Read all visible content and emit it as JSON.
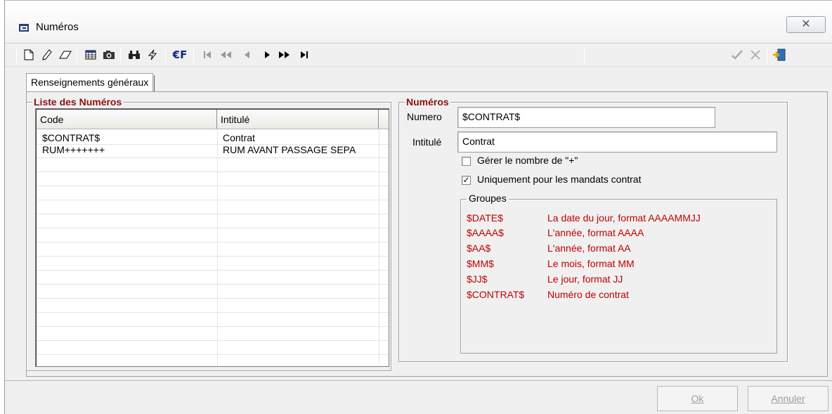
{
  "window": {
    "title": "Numéros",
    "close_glyph": "✕"
  },
  "toolbar": {
    "icons": [
      "new-document-icon",
      "edit-pencil-icon",
      "eraser-icon",
      "table-icon",
      "camera-icon",
      "binoculars-icon",
      "lightning-icon",
      "euro-franc-icon",
      "first-record-icon",
      "fast-back-icon",
      "previous-icon",
      "next-icon",
      "fast-forward-icon",
      "last-record-icon",
      "validate-check-icon",
      "cancel-x-icon",
      "exit-door-icon"
    ],
    "euro_label": "€F"
  },
  "tabs": [
    {
      "label": "Renseignements généraux"
    }
  ],
  "list": {
    "title": "Liste des Numéros",
    "columns": [
      "Code",
      "Intitulé"
    ],
    "rows": [
      {
        "code": "$CONTRAT$",
        "intitule": "Contrat"
      },
      {
        "code": "RUM+++++++",
        "intitule": "RUM AVANT PASSAGE SEPA"
      }
    ]
  },
  "detail": {
    "title": "Numéros",
    "numero_label": "Numero",
    "numero_value": "$CONTRAT$",
    "intitule_label": "Intitulé",
    "intitule_value": "Contrat",
    "gerer_label": "Gérer le nombre de \"+\"",
    "gerer_checked": false,
    "mandats_label": "Uniquement pour les mandats contrat",
    "mandats_checked": true,
    "check_mark": "✓"
  },
  "groupes": {
    "title": "Groupes",
    "items": [
      {
        "key": "$DATE$",
        "desc": "La date du jour, format AAAAMMJJ"
      },
      {
        "key": "$AAAA$",
        "desc": "L'année, format AAAA"
      },
      {
        "key": "$AA$",
        "desc": "L'année, format AA"
      },
      {
        "key": "$MM$",
        "desc": "Le mois, format MM"
      },
      {
        "key": "$JJ$",
        "desc": "Le jour, format JJ"
      },
      {
        "key": "$CONTRAT$",
        "desc": "Numéro de contrat"
      }
    ],
    "color": "#c00000"
  },
  "buttons": {
    "ok_label": "Ok",
    "cancel_label": "Annuler"
  }
}
